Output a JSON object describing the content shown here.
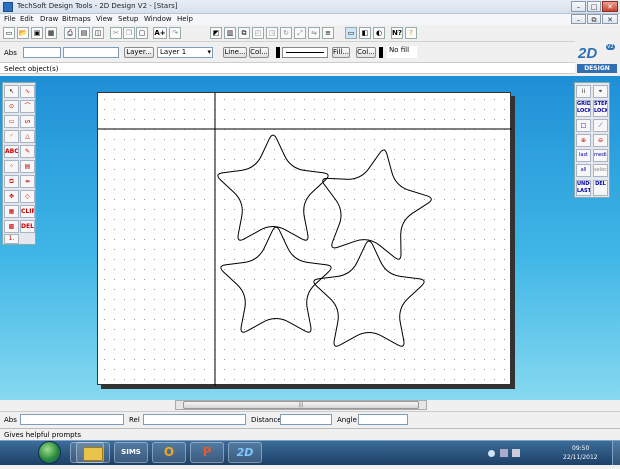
{
  "window": {
    "title": "TechSoft Design Tools - 2D Design V2 - [Stars]",
    "controls": {
      "minimize": "–",
      "maximize": "□",
      "close": "✕",
      "restore": "⧉"
    }
  },
  "menu": {
    "items": [
      "File",
      "Edit",
      "Draw",
      "Bitmaps",
      "View",
      "Setup",
      "Window",
      "Help"
    ]
  },
  "toolbar": {
    "icons": [
      "new-icon",
      "open-icon",
      "save-icon",
      "print-preview-icon",
      "print-icon",
      "save-all-icon",
      "cut-icon",
      "copy-icon",
      "paste-icon",
      "text-size-icon",
      "spell-icon",
      "select-icon",
      "clipboard-icon",
      "copy-object-icon",
      "group-icon",
      "paste-object-icon",
      "rotate-icon",
      "scale-icon",
      "mirror-icon",
      "align-icon",
      "delete-icon",
      "picture-icon",
      "image-icon",
      "color-icon",
      "help-icon",
      "hint-icon"
    ],
    "text_glyph": "A+",
    "help_glyph": "N?"
  },
  "properties": {
    "abs_label": "Abs",
    "abs_value": "",
    "abs_value2": "",
    "layer_button": "Layer...",
    "layer_value": "Layer 1",
    "line_button": "Line...",
    "col_button": "Col...",
    "fill_button": "Fill...",
    "col2_button": "Col...",
    "fill_value": "No fill"
  },
  "prompt": {
    "text": "Select object(s)"
  },
  "logo": {
    "text": "2D",
    "subtext": "DESIGN",
    "badge": "V2",
    "color": "#2f6fb4"
  },
  "left_tools": {
    "labels": [
      "ABC",
      "CLIP",
      "DEL",
      "1."
    ]
  },
  "right_tools": {
    "grid_lock": "GRID LOCK",
    "step_lock": "STEP LOCK",
    "last_label": "last",
    "media_label": "media",
    "all_label": "all",
    "selec_label": "selec",
    "undo_last": "UNDO LAST",
    "del_label": "DEL"
  },
  "coords": {
    "abs_label": "Abs",
    "rel_label": "Rel",
    "distance_label": "Distance",
    "angle_label": "Angle",
    "abs_value": "",
    "rel_value": "",
    "distance_value": "",
    "angle_value": ""
  },
  "status": {
    "text": "Gives helpful prompts"
  },
  "taskbar": {
    "apps": [
      "ie-icon",
      "folder-icon",
      "sims-icon",
      "outlook-icon",
      "powerpoint-icon",
      "2d-design-icon"
    ],
    "sims_label": "SIMS",
    "outlook_label": "O",
    "ppt_label": "P",
    "design_label": "2D",
    "time": "09:50",
    "date": "22/11/2012"
  },
  "colors": {
    "workspace_top": "#1f8fd6",
    "workspace_bottom": "#86d9f0",
    "taskbar": "#1d3f66",
    "accent_red": "#c00000"
  }
}
